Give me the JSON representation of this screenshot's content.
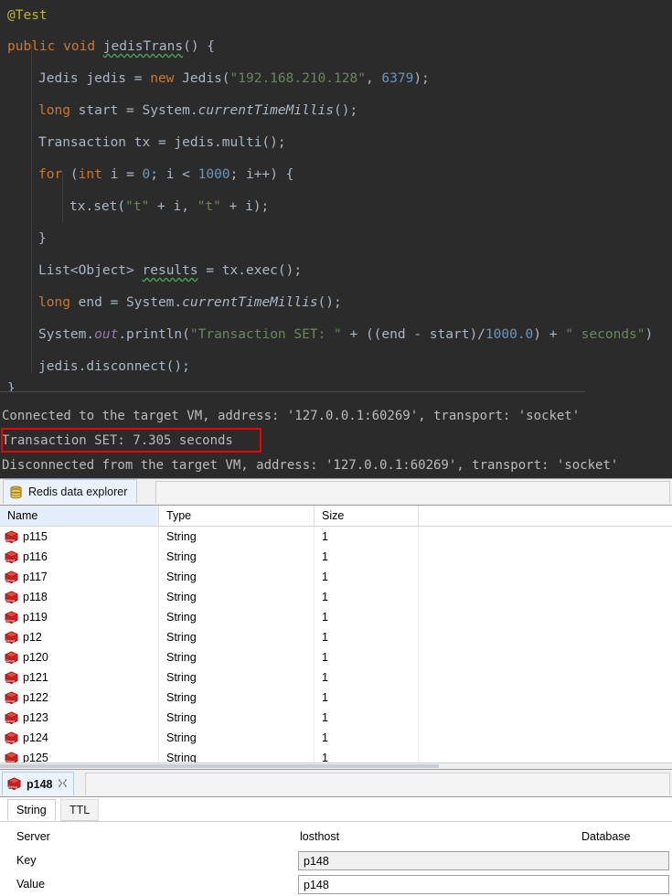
{
  "editor": {
    "lines": [
      {
        "indent": 0,
        "tokens": [
          {
            "t": "@Test",
            "c": "ann"
          }
        ]
      },
      {
        "indent": 0,
        "tokens": [
          {
            "t": "public",
            "c": "kw"
          },
          {
            "t": " ",
            "c": "plain"
          },
          {
            "t": "void",
            "c": "kw"
          },
          {
            "t": " ",
            "c": "plain"
          },
          {
            "t": "jedisTrans",
            "c": "squiggle-plain"
          },
          {
            "t": "() {",
            "c": "plain"
          }
        ]
      },
      {
        "indent": 1,
        "tokens": [
          {
            "t": "Jedis jedis = ",
            "c": "plain"
          },
          {
            "t": "new",
            "c": "kw"
          },
          {
            "t": " Jedis(",
            "c": "plain"
          },
          {
            "t": "\"192.168.210.128\"",
            "c": "str"
          },
          {
            "t": ", ",
            "c": "plain"
          },
          {
            "t": "6379",
            "c": "num"
          },
          {
            "t": ");",
            "c": "plain"
          }
        ]
      },
      {
        "indent": 1,
        "tokens": [
          {
            "t": "long",
            "c": "kw"
          },
          {
            "t": " start = System.",
            "c": "plain"
          },
          {
            "t": "currentTimeMillis",
            "c": "ital"
          },
          {
            "t": "();",
            "c": "plain"
          }
        ]
      },
      {
        "indent": 1,
        "tokens": [
          {
            "t": "Transaction tx = jedis.multi();",
            "c": "plain"
          }
        ]
      },
      {
        "indent": 1,
        "tokens": [
          {
            "t": "for",
            "c": "kw"
          },
          {
            "t": " (",
            "c": "plain"
          },
          {
            "t": "int",
            "c": "kw"
          },
          {
            "t": " i = ",
            "c": "plain"
          },
          {
            "t": "0",
            "c": "num"
          },
          {
            "t": "; i < ",
            "c": "plain"
          },
          {
            "t": "1000",
            "c": "num"
          },
          {
            "t": "; i++) {",
            "c": "plain"
          }
        ]
      },
      {
        "indent": 2,
        "tokens": [
          {
            "t": "tx.set(",
            "c": "plain"
          },
          {
            "t": "\"t\"",
            "c": "str"
          },
          {
            "t": " + i, ",
            "c": "plain"
          },
          {
            "t": "\"t\"",
            "c": "str"
          },
          {
            "t": " + i);",
            "c": "plain"
          }
        ]
      },
      {
        "indent": 1,
        "tokens": [
          {
            "t": "}",
            "c": "plain"
          }
        ]
      },
      {
        "indent": 1,
        "tokens": [
          {
            "t": "List<Object> ",
            "c": "plain"
          },
          {
            "t": "results",
            "c": "squiggle-plain"
          },
          {
            "t": " = tx.exec();",
            "c": "plain"
          }
        ]
      },
      {
        "indent": 1,
        "tokens": [
          {
            "t": "long",
            "c": "kw"
          },
          {
            "t": " end = System.",
            "c": "plain"
          },
          {
            "t": "currentTimeMillis",
            "c": "ital"
          },
          {
            "t": "();",
            "c": "plain"
          }
        ]
      },
      {
        "indent": 1,
        "tokens": [
          {
            "t": "System.",
            "c": "plain"
          },
          {
            "t": "out",
            "c": "stat"
          },
          {
            "t": ".println(",
            "c": "plain"
          },
          {
            "t": "\"Transaction SET: \"",
            "c": "str"
          },
          {
            "t": " + ((end - start)/",
            "c": "plain"
          },
          {
            "t": "1000.0",
            "c": "num"
          },
          {
            "t": ") + ",
            "c": "plain"
          },
          {
            "t": "\" seconds\"",
            "c": "str"
          },
          {
            "t": ")",
            "c": "plain"
          }
        ]
      },
      {
        "indent": 1,
        "tokens": [
          {
            "t": "jedis.disconnect();",
            "c": "plain"
          }
        ]
      },
      {
        "indent": 0,
        "tokens": [
          {
            "t": "}",
            "c": "plain"
          }
        ]
      }
    ]
  },
  "console": {
    "lines": [
      "Connected to the target VM, address: '127.0.0.1:60269', transport: 'socket'",
      "Transaction SET: 7.305 seconds",
      "Disconnected from the target VM, address: '127.0.0.1:60269', transport: 'socket'"
    ],
    "highlight_color": "#ee0000",
    "highlighted_line_index": 1
  },
  "redis": {
    "view_tab": {
      "label": "Redis data explorer",
      "icon": "database-icon"
    },
    "table": {
      "columns": [
        "Name",
        "Type",
        "Size"
      ],
      "sorted_column": "Name",
      "rows": [
        {
          "name": "p115",
          "type": "String",
          "size": "1",
          "icon": "string-key-icon"
        },
        {
          "name": "p116",
          "type": "String",
          "size": "1",
          "icon": "string-key-icon"
        },
        {
          "name": "p117",
          "type": "String",
          "size": "1",
          "icon": "string-key-icon"
        },
        {
          "name": "p118",
          "type": "String",
          "size": "1",
          "icon": "string-key-icon"
        },
        {
          "name": "p119",
          "type": "String",
          "size": "1",
          "icon": "string-key-icon"
        },
        {
          "name": "p12",
          "type": "String",
          "size": "1",
          "icon": "string-key-icon"
        },
        {
          "name": "p120",
          "type": "String",
          "size": "1",
          "icon": "string-key-icon"
        },
        {
          "name": "p121",
          "type": "String",
          "size": "1",
          "icon": "string-key-icon"
        },
        {
          "name": "p122",
          "type": "String",
          "size": "1",
          "icon": "string-key-icon"
        },
        {
          "name": "p123",
          "type": "String",
          "size": "1",
          "icon": "string-key-icon"
        },
        {
          "name": "p124",
          "type": "String",
          "size": "1",
          "icon": "string-key-icon"
        },
        {
          "name": "p125",
          "type": "String",
          "size": "1",
          "icon": "string-key-icon"
        }
      ]
    },
    "detail": {
      "tab_label": "p148",
      "tab_icon": "string-key-icon",
      "close_icon": "close-icon",
      "subtabs": [
        {
          "label": "String",
          "active": true
        },
        {
          "label": "TTL",
          "active": false
        }
      ],
      "fields": [
        {
          "label": "Server",
          "value": "losthost",
          "kind": "text",
          "extra_label": "Database"
        },
        {
          "label": "Key",
          "value": "p148",
          "kind": "input"
        },
        {
          "label": "Value",
          "value": "p148",
          "kind": "input"
        }
      ]
    }
  }
}
